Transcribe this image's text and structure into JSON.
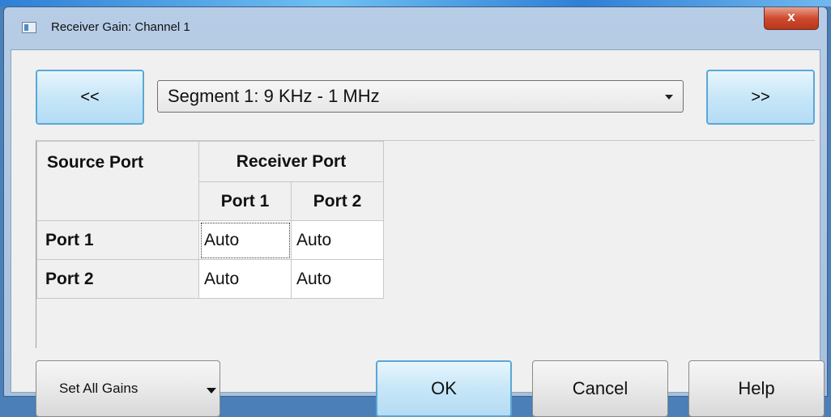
{
  "window": {
    "title": "Receiver Gain: Channel 1",
    "close_glyph": "x"
  },
  "navigation": {
    "prev_label": "<<",
    "next_label": ">>",
    "segment_selected": "Segment 1: 9 KHz - 1 MHz"
  },
  "grid": {
    "source_header": "Source Port",
    "receiver_header": "Receiver Port",
    "columns": [
      "Port 1",
      "Port 2"
    ],
    "rows": [
      {
        "label": "Port 1",
        "values": [
          "Auto",
          "Auto"
        ]
      },
      {
        "label": "Port 2",
        "values": [
          "Auto",
          "Auto"
        ]
      }
    ]
  },
  "buttons": {
    "set_all_gains": "Set All Gains",
    "ok": "OK",
    "cancel": "Cancel",
    "help": "Help"
  },
  "icons": {
    "window_icon": "app-window-icon",
    "close": "close-icon",
    "dropdown": "chevron-down-icon"
  },
  "colors": {
    "accent": "#5aa7d8",
    "close": "#cf4b2f"
  }
}
